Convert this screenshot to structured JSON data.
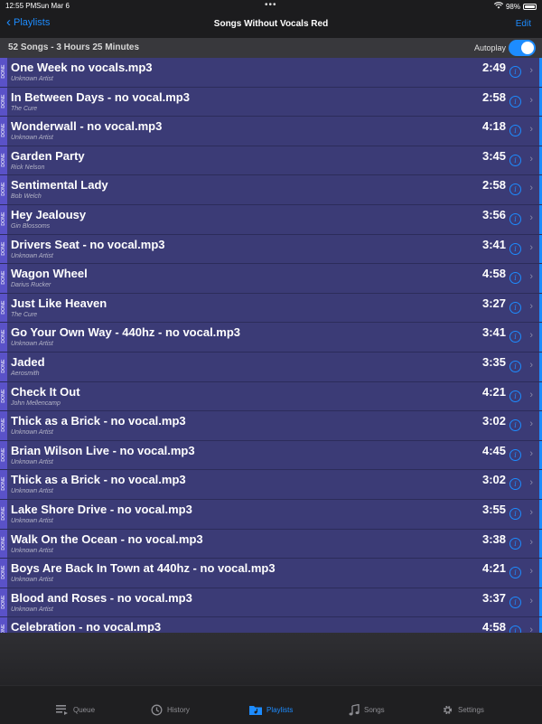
{
  "status": {
    "time": "12:55 PM",
    "date": "Sun Mar 6",
    "battery_percent_text": "98%",
    "battery_level": 0.98
  },
  "nav": {
    "back_label": "Playlists",
    "title": "Songs Without Vocals Red",
    "edit_label": "Edit"
  },
  "summary": {
    "text": "52 Songs - 3 Hours 25 Minutes",
    "autoplay_label": "Autoplay",
    "autoplay_on": true
  },
  "done_label": "DONE",
  "songs": [
    {
      "title": "One Week no vocals.mp3",
      "artist": "Unknown Artist",
      "duration": "2:49"
    },
    {
      "title": "In Between Days - no vocal.mp3",
      "artist": "The Cure",
      "duration": "2:58"
    },
    {
      "title": "Wonderwall - no vocal.mp3",
      "artist": "Unknown Artist",
      "duration": "4:18"
    },
    {
      "title": "Garden Party",
      "artist": "Rick Nelson",
      "duration": "3:45"
    },
    {
      "title": "Sentimental Lady",
      "artist": "Bob Welch",
      "duration": "2:58"
    },
    {
      "title": "Hey Jealousy",
      "artist": "Gin Blossoms",
      "duration": "3:56"
    },
    {
      "title": "Drivers Seat - no vocal.mp3",
      "artist": "Unknown Artist",
      "duration": "3:41"
    },
    {
      "title": "Wagon Wheel",
      "artist": "Darius Rucker",
      "duration": "4:58"
    },
    {
      "title": "Just Like Heaven",
      "artist": "The Cure",
      "duration": "3:27"
    },
    {
      "title": "Go Your Own Way - 440hz - no vocal.mp3",
      "artist": "Unknown Artist",
      "duration": "3:41"
    },
    {
      "title": "Jaded",
      "artist": "Aerosmith",
      "duration": "3:35"
    },
    {
      "title": "Check It Out",
      "artist": "John Mellencamp",
      "duration": "4:21"
    },
    {
      "title": "Thick as a Brick - no vocal.mp3",
      "artist": "Unknown Artist",
      "duration": "3:02"
    },
    {
      "title": "Brian Wilson Live - no vocal.mp3",
      "artist": "Unknown Artist",
      "duration": "4:45"
    },
    {
      "title": "Thick as a Brick - no vocal.mp3",
      "artist": "Unknown Artist",
      "duration": "3:02"
    },
    {
      "title": "Lake Shore Drive - no vocal.mp3",
      "artist": "Unknown Artist",
      "duration": "3:55"
    },
    {
      "title": "Walk On the Ocean - no vocal.mp3",
      "artist": "Unknown Artist",
      "duration": "3:38"
    },
    {
      "title": "Boys Are Back In Town at 440hz - no vocal.mp3",
      "artist": "Unknown Artist",
      "duration": "4:21"
    },
    {
      "title": "Blood and Roses - no vocal.mp3",
      "artist": "Unknown Artist",
      "duration": "3:37"
    },
    {
      "title": "Celebration - no vocal.mp3",
      "artist": "",
      "duration": "4:58"
    }
  ],
  "tabs": [
    {
      "label": "Queue",
      "icon": "queue-icon",
      "active": false
    },
    {
      "label": "History",
      "icon": "history-icon",
      "active": false
    },
    {
      "label": "Playlists",
      "icon": "playlists-icon",
      "active": true
    },
    {
      "label": "Songs",
      "icon": "music-note-icon",
      "active": false
    },
    {
      "label": "Settings",
      "icon": "gear-icon",
      "active": false
    }
  ],
  "colors": {
    "accent": "#1d8cff",
    "row_background": "#3b3b76",
    "done_stripe": "#5a52c8"
  }
}
